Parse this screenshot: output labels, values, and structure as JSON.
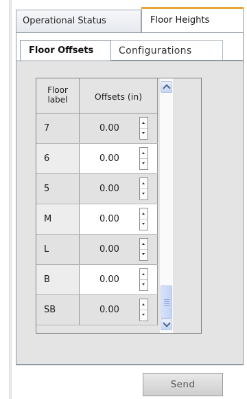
{
  "tabs": {
    "operational_status": "Operational Status",
    "floor_heights": "Floor Heights"
  },
  "subtabs": {
    "floor_offsets": "Floor Offsets",
    "configurations": "Configurations"
  },
  "table": {
    "col_floor_label": "Floor label",
    "col_offsets": "Offsets (in)",
    "rows": [
      {
        "label": "7",
        "offset": "0.00"
      },
      {
        "label": "6",
        "offset": "0.00"
      },
      {
        "label": "5",
        "offset": "0.00"
      },
      {
        "label": "M",
        "offset": "0.00"
      },
      {
        "label": "L",
        "offset": "0.00"
      },
      {
        "label": "B",
        "offset": "0.00"
      },
      {
        "label": "SB",
        "offset": "0.00"
      }
    ]
  },
  "send_label": "Send"
}
